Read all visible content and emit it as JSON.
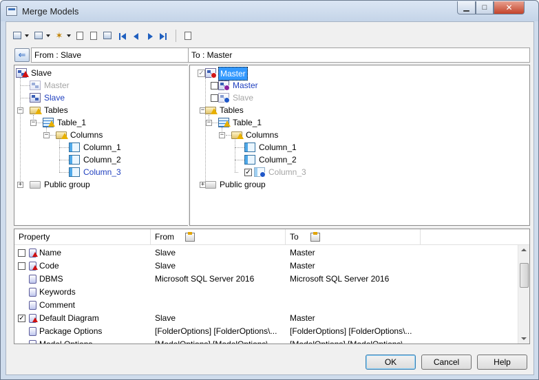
{
  "window": {
    "title": "Merge Models"
  },
  "panels": {
    "from_label": "From : Slave",
    "to_label": "To : Master"
  },
  "toolbar": {
    "icons": [
      "copy-icon",
      "copy-alt-icon",
      "wand-icon",
      "properties-icon",
      "find-icon",
      "compare-icon",
      "first-icon",
      "previous-icon",
      "next-icon",
      "last-icon",
      "report-icon"
    ]
  },
  "left_tree": [
    {
      "label": "Slave",
      "style": "normal"
    },
    {
      "label": "Master",
      "style": "gray"
    },
    {
      "label": "Slave",
      "style": "blue"
    },
    {
      "label": "Tables",
      "style": "normal"
    },
    {
      "label": "Table_1",
      "style": "normal"
    },
    {
      "label": "Columns",
      "style": "normal"
    },
    {
      "label": "Column_1",
      "style": "normal"
    },
    {
      "label": "Column_2",
      "style": "normal"
    },
    {
      "label": "Column_3",
      "style": "blue"
    },
    {
      "label": "Public group",
      "style": "normal"
    }
  ],
  "right_tree": [
    {
      "label": "Master",
      "style": "selected",
      "checked": true
    },
    {
      "label": "Master",
      "style": "blue",
      "checked": false
    },
    {
      "label": "Slave",
      "style": "gray",
      "checked": false
    },
    {
      "label": "Tables",
      "style": "normal"
    },
    {
      "label": "Table_1",
      "style": "normal"
    },
    {
      "label": "Columns",
      "style": "normal"
    },
    {
      "label": "Column_1",
      "style": "normal"
    },
    {
      "label": "Column_2",
      "style": "normal"
    },
    {
      "label": "Column_3",
      "style": "gray",
      "checked": true
    },
    {
      "label": "Public group",
      "style": "normal"
    }
  ],
  "properties": {
    "headers": {
      "property": "Property",
      "from": "From",
      "to": "To"
    },
    "rows": [
      {
        "name": "Name",
        "from": "Slave",
        "to": "Master",
        "checkbox": true,
        "checked": false,
        "warn": true
      },
      {
        "name": "Code",
        "from": "Slave",
        "to": "Master",
        "checkbox": true,
        "checked": false,
        "warn": true
      },
      {
        "name": "DBMS",
        "from": "Microsoft SQL Server 2016",
        "to": "Microsoft SQL Server 2016",
        "checkbox": false,
        "warn": false
      },
      {
        "name": "Keywords",
        "from": "",
        "to": "",
        "checkbox": false,
        "warn": false
      },
      {
        "name": "Comment",
        "from": "",
        "to": "",
        "checkbox": false,
        "warn": false
      },
      {
        "name": "Default Diagram",
        "from": "Slave",
        "to": "Master",
        "checkbox": true,
        "checked": true,
        "warn": true
      },
      {
        "name": "Package Options",
        "from": "[FolderOptions]  [FolderOptions\\...",
        "to": "[FolderOptions]  [FolderOptions\\...",
        "checkbox": false,
        "warn": false
      },
      {
        "name": "Model Options",
        "from": "[ModelOptions]  [ModelOptions\\...",
        "to": "[ModelOptions]  [ModelOptions\\...",
        "checkbox": false,
        "warn": false
      }
    ]
  },
  "buttons": {
    "ok": "OK",
    "cancel": "Cancel",
    "help": "Help"
  }
}
